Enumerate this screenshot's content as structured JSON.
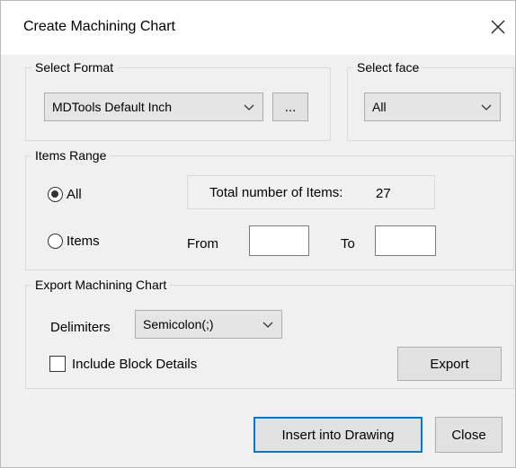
{
  "window": {
    "title": "Create Machining Chart",
    "close_icon": "close-icon"
  },
  "select_format": {
    "legend": "Select Format",
    "format_value": "MDTools Default Inch",
    "browse_label": "..."
  },
  "select_face": {
    "legend": "Select face",
    "face_value": "All"
  },
  "items_range": {
    "legend": "Items Range",
    "radio_all_label": "All",
    "radio_all_selected": true,
    "radio_items_label": "Items",
    "total_label": "Total number of Items:",
    "total_value": "27",
    "from_label": "From",
    "from_value": "",
    "to_label": "To",
    "to_value": ""
  },
  "export": {
    "legend": "Export Machining Chart",
    "delimiters_label": "Delimiters",
    "delimiters_value": "Semicolon(;)",
    "include_block_details_label": "Include Block Details",
    "include_block_details_checked": false,
    "export_button": "Export"
  },
  "footer": {
    "insert_button": "Insert into Drawing",
    "close_button": "Close"
  }
}
